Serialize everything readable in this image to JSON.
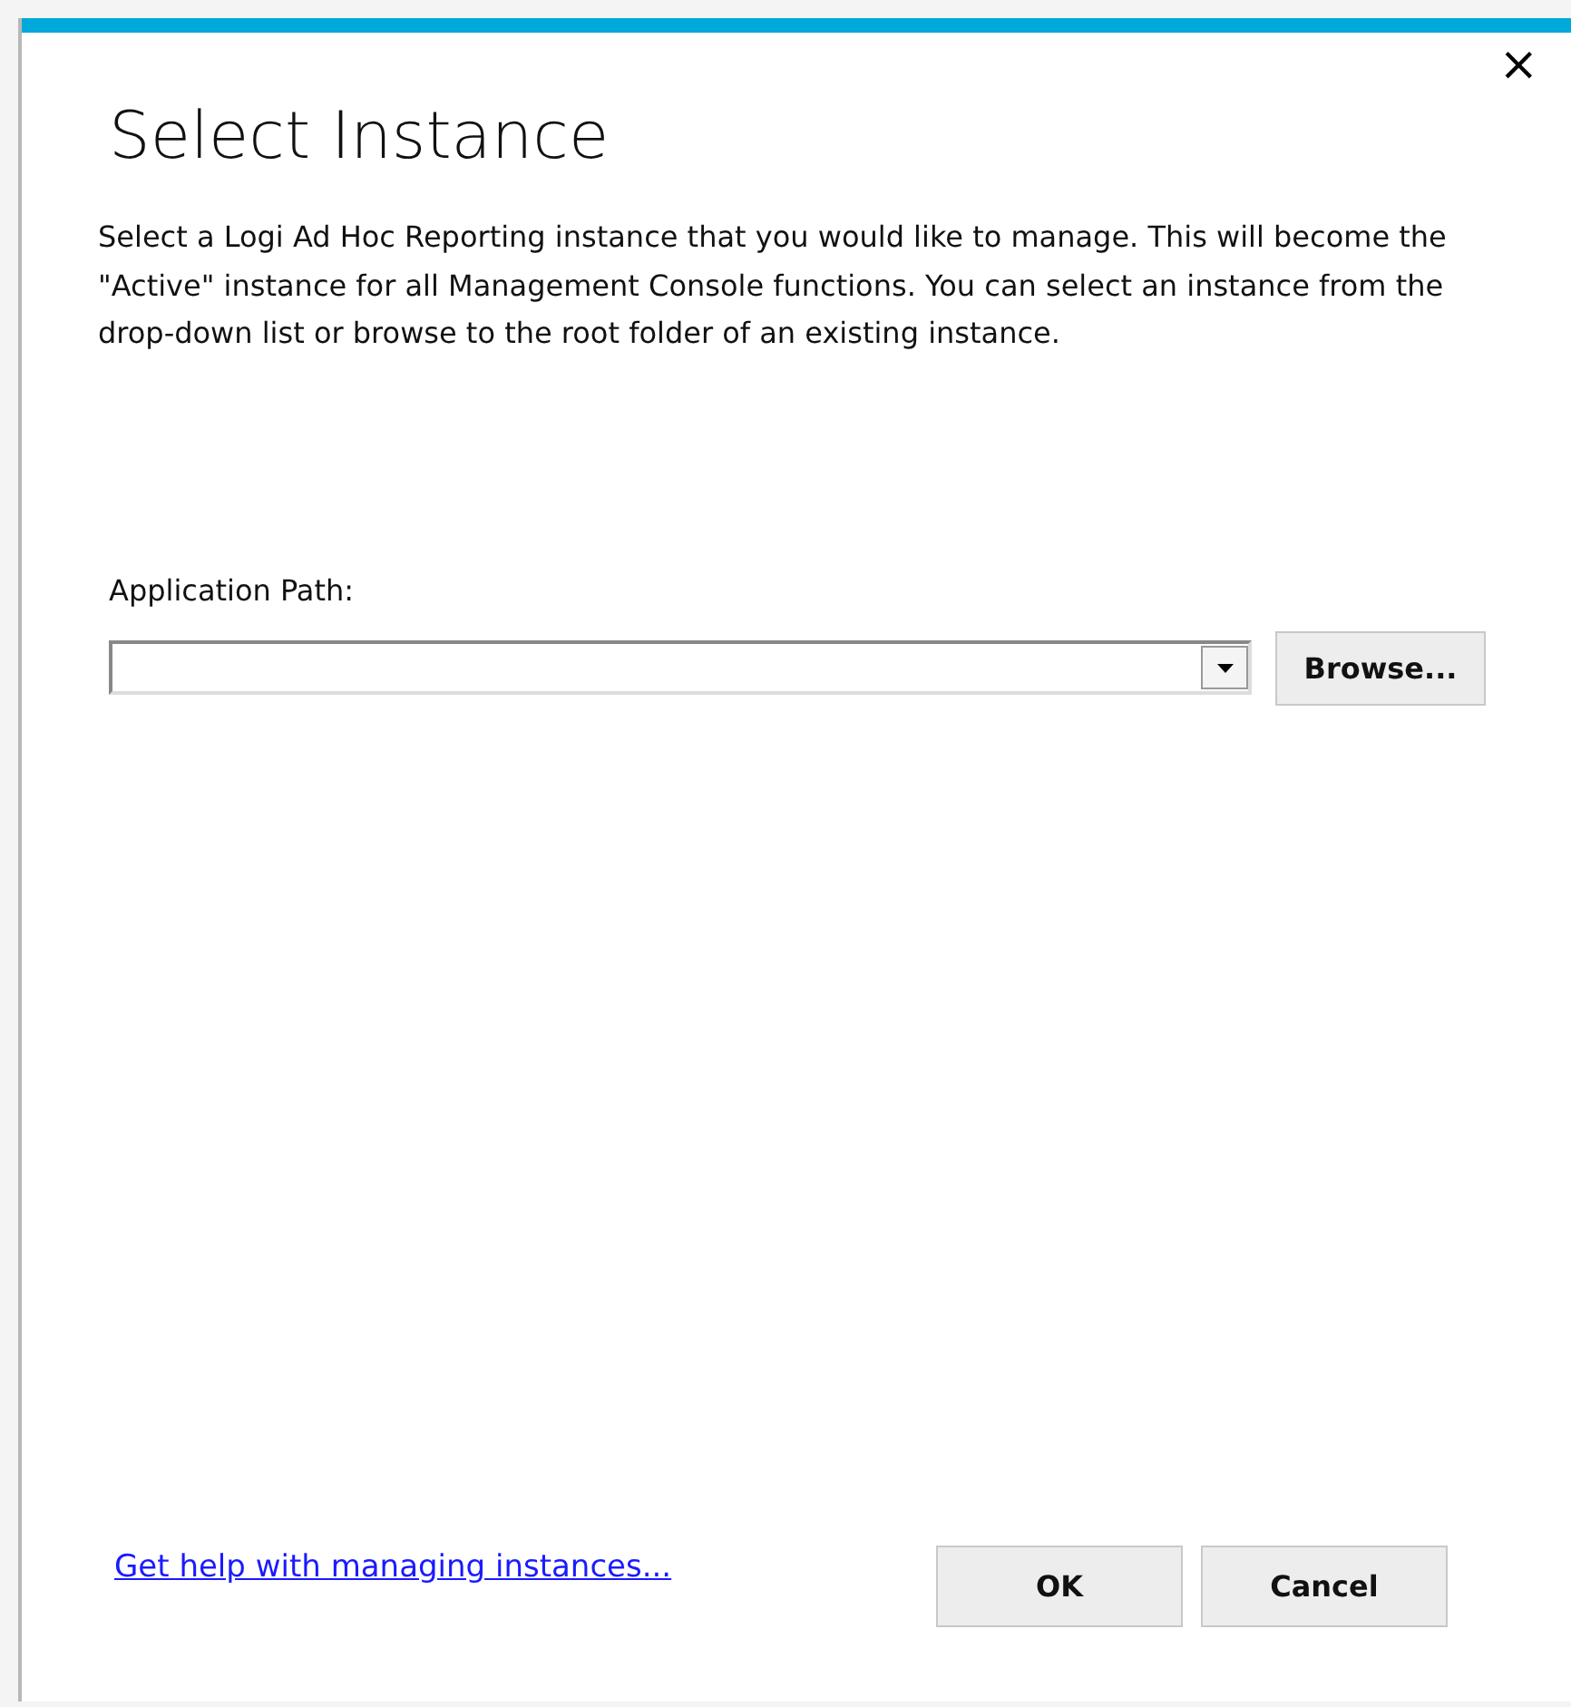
{
  "dialog": {
    "title": "Select Instance",
    "close": "×",
    "description": "Select a Logi Ad Hoc Reporting instance that you would like to manage. This will become the \"Active\" instance for all Management Console functions. You can select an instance from the drop-down list or browse to the root folder of an existing instance.",
    "path_label": "Application Path:",
    "browse_button": "Browse...",
    "help_link": "Get help with managing instances...",
    "buttons": [
      "OK",
      "Cancel"
    ]
  }
}
